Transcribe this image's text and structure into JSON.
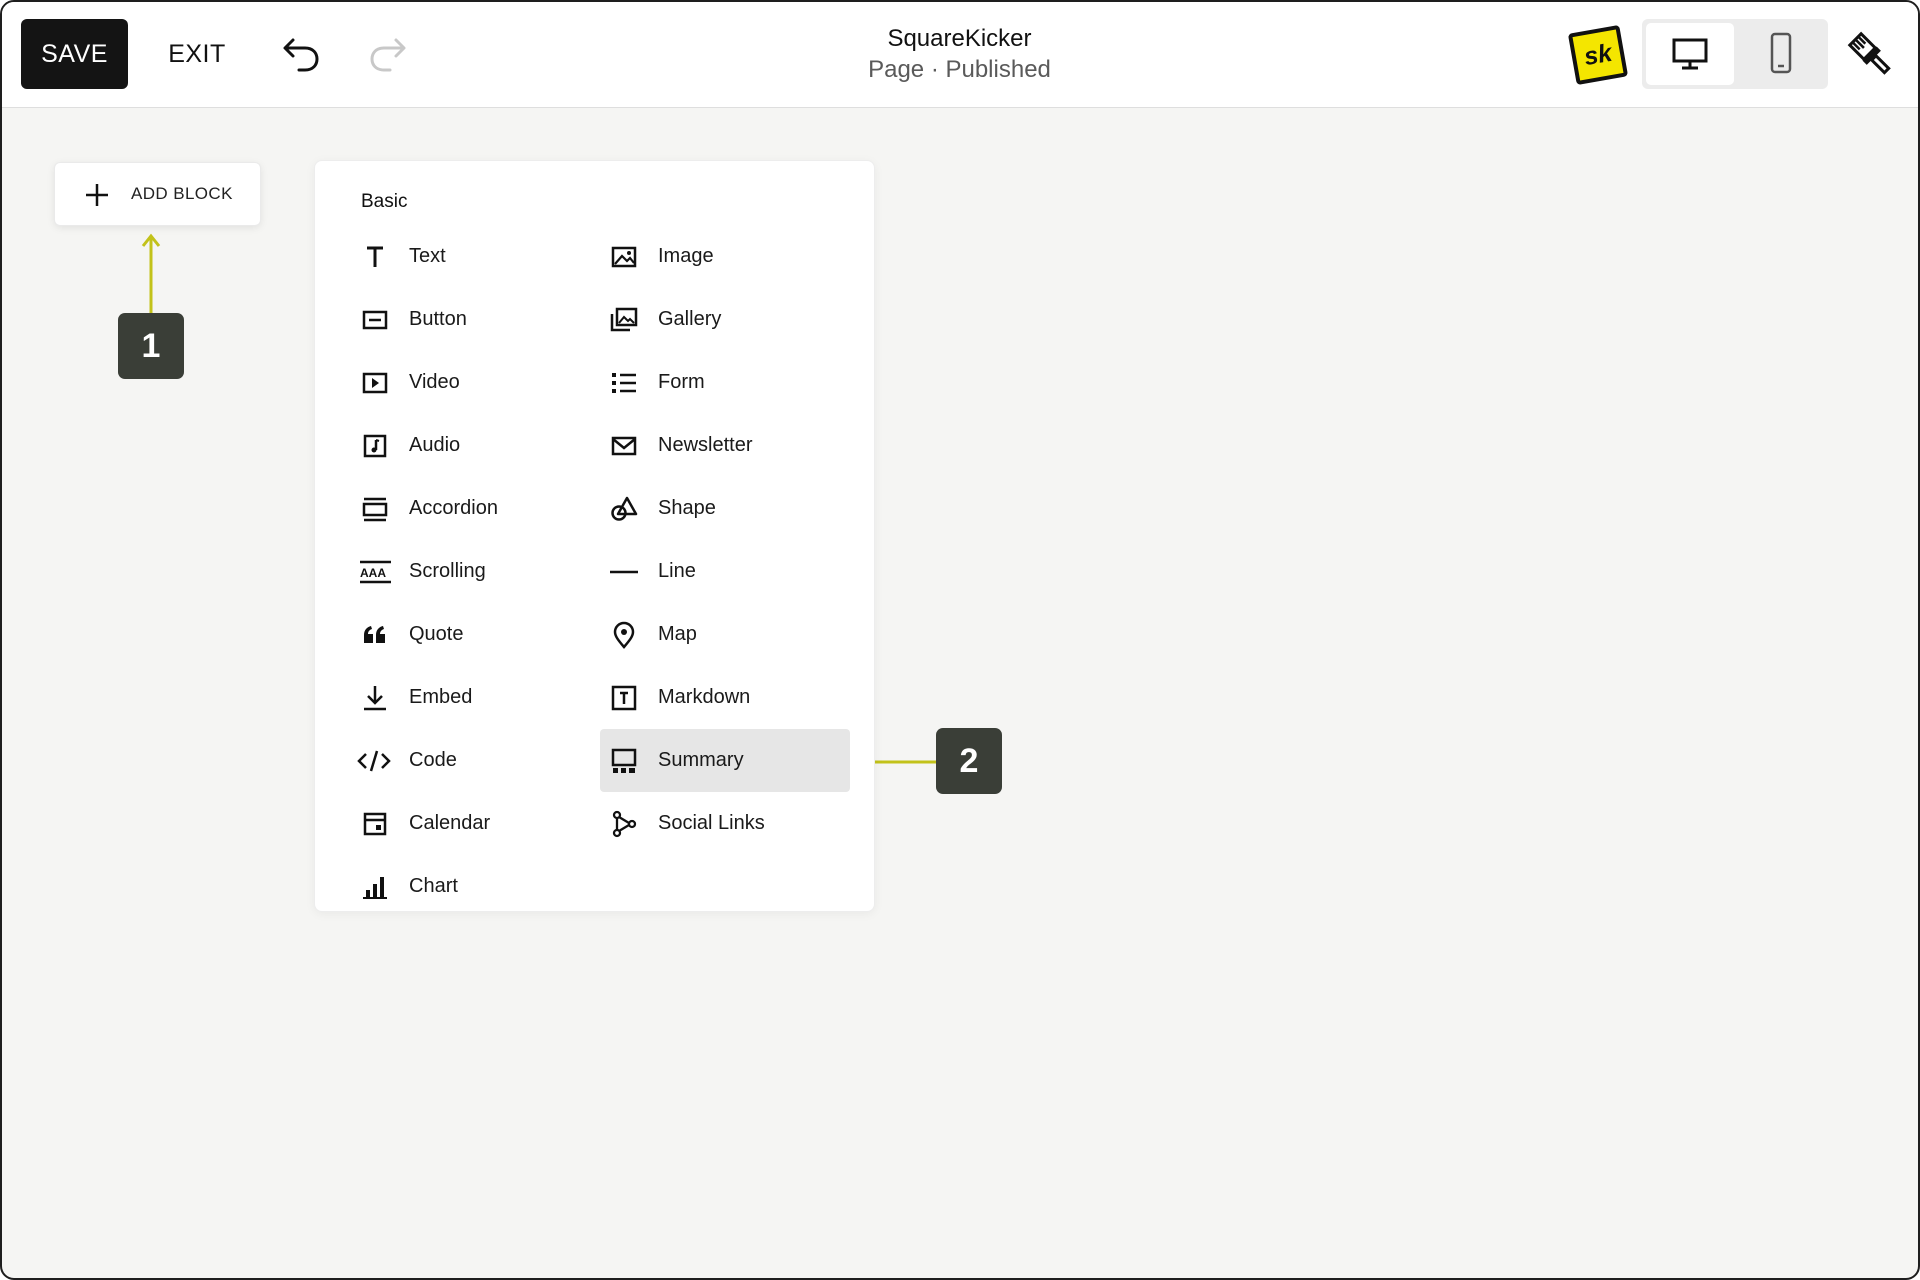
{
  "toolbar": {
    "save_label": "SAVE",
    "exit_label": "EXIT",
    "undo_icon": "undo-arrow-icon",
    "redo_icon": "redo-arrow-icon"
  },
  "header": {
    "site_title": "SquareKicker",
    "page_status": "Page · Published"
  },
  "right_tools": {
    "logo_text": "sk",
    "logo_color": "#f4e600",
    "device_options": [
      "desktop",
      "mobile"
    ],
    "selected_device": "desktop",
    "style_icon": "paintbrush-icon"
  },
  "add_block": {
    "label": "ADD BLOCK",
    "icon": "plus-icon"
  },
  "block_menu": {
    "heading": "Basic",
    "left_column": [
      {
        "label": "Text",
        "icon": "text-icon"
      },
      {
        "label": "Button",
        "icon": "button-icon"
      },
      {
        "label": "Video",
        "icon": "video-icon"
      },
      {
        "label": "Audio",
        "icon": "audio-icon"
      },
      {
        "label": "Accordion",
        "icon": "accordion-icon"
      },
      {
        "label": "Scrolling",
        "icon": "scrolling-icon"
      },
      {
        "label": "Quote",
        "icon": "quote-icon"
      },
      {
        "label": "Embed",
        "icon": "embed-icon"
      },
      {
        "label": "Code",
        "icon": "code-icon"
      },
      {
        "label": "Calendar",
        "icon": "calendar-icon"
      },
      {
        "label": "Chart",
        "icon": "chart-icon"
      }
    ],
    "right_column": [
      {
        "label": "Image",
        "icon": "image-icon"
      },
      {
        "label": "Gallery",
        "icon": "gallery-icon"
      },
      {
        "label": "Form",
        "icon": "form-icon"
      },
      {
        "label": "Newsletter",
        "icon": "newsletter-icon"
      },
      {
        "label": "Shape",
        "icon": "shape-icon"
      },
      {
        "label": "Line",
        "icon": "line-icon"
      },
      {
        "label": "Map",
        "icon": "map-pin-icon"
      },
      {
        "label": "Markdown",
        "icon": "markdown-icon"
      },
      {
        "label": "Summary",
        "icon": "summary-icon"
      },
      {
        "label": "Social Links",
        "icon": "social-links-icon"
      }
    ],
    "highlighted_item": "Summary"
  },
  "callouts": [
    {
      "number": "1"
    },
    {
      "number": "2"
    }
  ],
  "colors": {
    "arrow": "#c2c21a",
    "callout_bg": "#3a3e37",
    "canvas_bg": "#f5f5f3",
    "highlight_bg": "#e6e6e6"
  }
}
